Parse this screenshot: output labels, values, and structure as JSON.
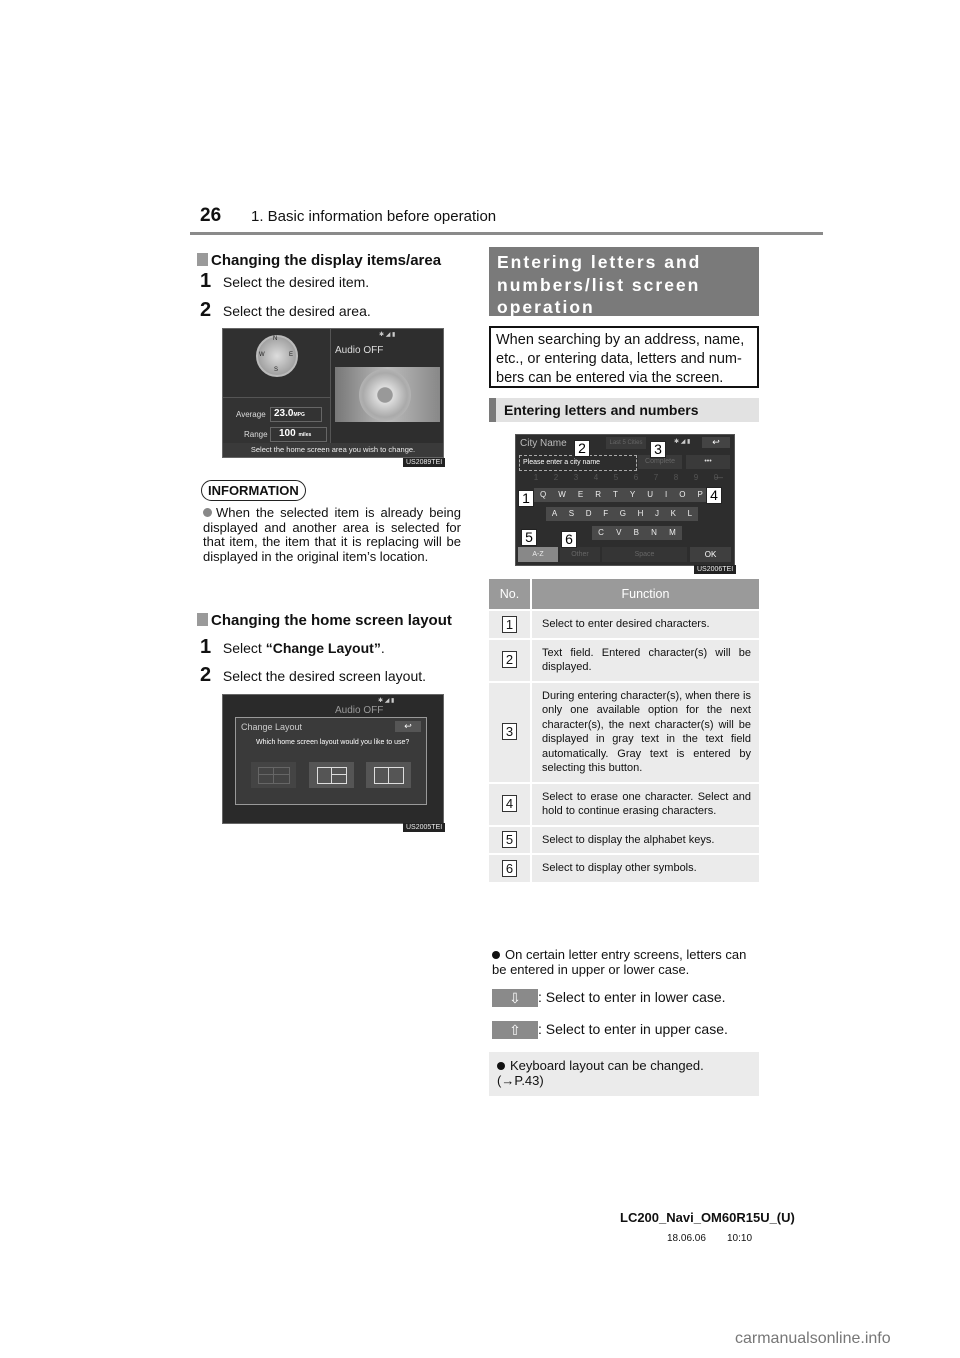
{
  "header": {
    "page_number": "26",
    "running_head": "1. Basic information before operation"
  },
  "left": {
    "section1": {
      "heading": "Changing the display items/area",
      "steps": [
        {
          "num": "1",
          "text": "Select the desired item."
        },
        {
          "num": "2",
          "text": "Select the desired area."
        }
      ],
      "screen": {
        "audio": "Audio OFF",
        "average_label": "Average",
        "average_value": "23.0",
        "average_unit": "MPG",
        "range_label": "Range",
        "range_value": "100",
        "range_unit": "miles",
        "prompt": "Select the home screen area you wish to change.",
        "code": "US2089TEI",
        "compass": [
          "N",
          "E",
          "S",
          "W"
        ]
      }
    },
    "information": {
      "badge": "INFORMATION",
      "text": "When the selected item is already being displayed and another area is selected for that item, the item that it is replacing will be displayed in the original item’s location."
    },
    "section2": {
      "heading": "Changing the home screen layout",
      "steps": [
        {
          "num": "1",
          "prefix": "Select ",
          "bold": "“Change Layout”",
          "suffix": "."
        },
        {
          "num": "2",
          "text": "Select the desired screen layout."
        }
      ],
      "screen": {
        "audio": "Audio OFF",
        "dialog_title": "Change Layout",
        "question": "Which home screen layout would you like to use?",
        "back_icon": "↩",
        "code": "US2005TEI"
      }
    }
  },
  "right": {
    "section_title": "Entering letters and numbers/list screen operation",
    "section_title_lines": [
      "Entering letters and",
      "numbers/list screen",
      "operation"
    ],
    "intro": "When searching by an address, name, etc., or entering data, letters and numbers can be entered via the screen.",
    "intro_lines": [
      "When searching by an address, name,",
      "etc., or entering data, letters and num-",
      "bers can be entered via the screen."
    ],
    "subheading": "Entering letters and numbers",
    "keyboard": {
      "title": "City Name",
      "last5": "Last 5 Cities",
      "placeholder": "Please enter a city name",
      "complete": "Complete",
      "more": "•••",
      "numbers": [
        "1",
        "2",
        "3",
        "4",
        "5",
        "6",
        "7",
        "8",
        "9",
        "0"
      ],
      "row1": [
        "Q",
        "W",
        "E",
        "R",
        "T",
        "Y",
        "U",
        "I",
        "O",
        "P"
      ],
      "row2": [
        "A",
        "S",
        "D",
        "F",
        "G",
        "H",
        "J",
        "K",
        "L"
      ],
      "row3": [
        "C",
        "V",
        "B",
        "N",
        "M"
      ],
      "az": "A-Z",
      "other": "Other",
      "space": "Space",
      "ok": "OK",
      "back_icon": "↩",
      "code": "US2006TEI",
      "callouts": [
        "1",
        "2",
        "3",
        "4",
        "5",
        "6"
      ]
    },
    "table": {
      "headers": [
        "No.",
        "Function"
      ],
      "rows": [
        {
          "no": "1",
          "text": "Select to enter desired characters."
        },
        {
          "no": "2",
          "text": "Text field. Entered character(s) will be displayed."
        },
        {
          "no": "3",
          "text": "During entering character(s), when there is only one available option for the next character(s), the next character(s) will be displayed in gray text in the text field automatically. Gray text is entered by selecting this button."
        },
        {
          "no": "4",
          "text": "Select to erase one character. Select and hold to continue erasing characters."
        },
        {
          "no": "5",
          "text": "Select to display the alphabet keys."
        },
        {
          "no": "6",
          "text": "Select to display other symbols."
        }
      ]
    },
    "case_note": "On certain letter entry screens, letters can be entered in upper or lower case.",
    "lower_case": {
      "icon": "⇩",
      "text": ": Select to enter in lower case."
    },
    "upper_case": {
      "icon": "⇧",
      "text": ": Select to enter in upper case."
    },
    "keyboard_note": "Keyboard layout can be changed. (→P.43)"
  },
  "footer": {
    "doc_id": "LC200_Navi_OM60R15U_(U)",
    "date": "18.06.06",
    "time": "10:10",
    "watermark": "carmanualsonline.info"
  }
}
